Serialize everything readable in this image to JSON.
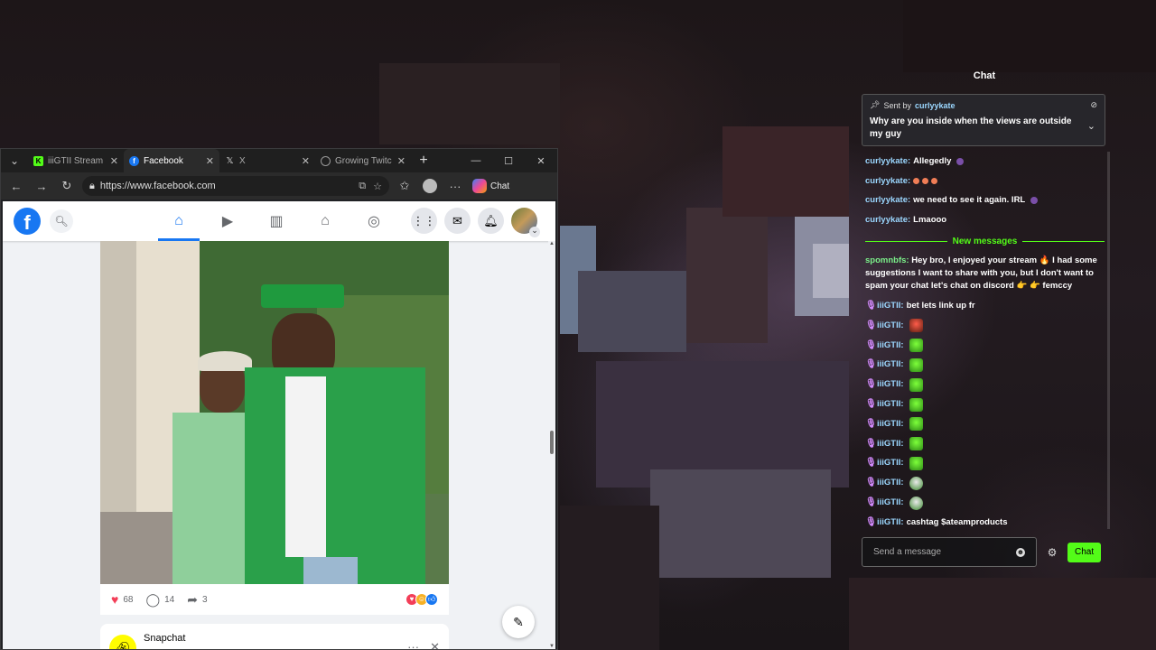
{
  "browser": {
    "tabs": [
      {
        "title": "iiiGTII Stream -",
        "favicon": "kick-logo-icon",
        "active": false
      },
      {
        "title": "Facebook",
        "favicon": "facebook-logo-icon",
        "active": true
      },
      {
        "title": "X",
        "favicon": "x-logo-icon",
        "active": false
      },
      {
        "title": "Growing Twitc",
        "favicon": "globe-icon",
        "active": false
      }
    ],
    "new_tab": "+",
    "url": "https://www.facebook.com",
    "chat_label": "Chat"
  },
  "facebook": {
    "post": {
      "likes": "68",
      "comments": "14",
      "shares": "3"
    },
    "next_post_author": "Snapchat"
  },
  "chat": {
    "title": "Chat",
    "pinned": {
      "sent_by": "Sent by",
      "user": "curlyykate",
      "message": "Why are you inside when the views are outside my guy"
    },
    "messages_before": [
      {
        "user": "curlyykate:",
        "text": "Allegedly",
        "emote": "purple-dot"
      },
      {
        "user": "curlyykate:",
        "text": "",
        "emote": "three-faces"
      },
      {
        "user": "curlyykate:",
        "text": "we need to see it again. IRL",
        "emote": "purple-dot"
      },
      {
        "user": "curlyykate:",
        "text": "Lmaooo",
        "emote": ""
      }
    ],
    "new_messages_label": "New messages",
    "long_message": {
      "user": "spomnbfs:",
      "text": "Hey bro, I enjoyed your stream 🔥 I had some suggestions I want to share with you, but I don't want to spam your chat let's chat on discord 👉 👉 femccy"
    },
    "owner_messages": [
      {
        "user": "iiiGTII:",
        "text": "bet lets link up fr",
        "emote": ""
      },
      {
        "user": "iiiGTII:",
        "text": "",
        "emote": "red"
      },
      {
        "user": "iiiGTII:",
        "text": "",
        "emote": "green"
      },
      {
        "user": "iiiGTII:",
        "text": "",
        "emote": "green"
      },
      {
        "user": "iiiGTII:",
        "text": "",
        "emote": "green"
      },
      {
        "user": "iiiGTII:",
        "text": "",
        "emote": "green"
      },
      {
        "user": "iiiGTII:",
        "text": "",
        "emote": "green"
      },
      {
        "user": "iiiGTII:",
        "text": "",
        "emote": "green"
      },
      {
        "user": "iiiGTII:",
        "text": "",
        "emote": "green"
      },
      {
        "user": "iiiGTII:",
        "text": "",
        "emote": "face"
      },
      {
        "user": "iiiGTII:",
        "text": "",
        "emote": "face"
      },
      {
        "user": "iiiGTII:",
        "text": "cashtag $ateamproducts",
        "emote": ""
      }
    ],
    "input_placeholder": "Send a message",
    "send_label": "Chat"
  },
  "colors": {
    "kick_green": "#53fc18",
    "facebook_blue": "#1877f2",
    "chat_username": "#9bd7ff",
    "mic_badge": "#d58bff"
  }
}
